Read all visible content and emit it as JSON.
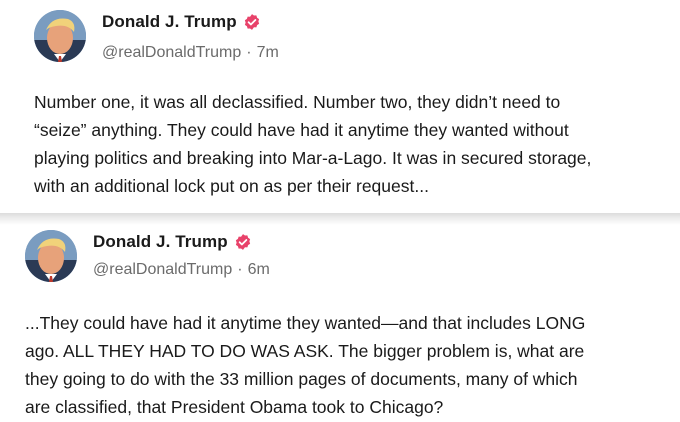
{
  "posts": [
    {
      "author": {
        "display_name": "Donald J. Trump",
        "verified": true,
        "handle": "@realDonaldTrump",
        "time": "7m"
      },
      "body": "Number one, it was all declassified. Number two, they didn’t need to\n“seize” anything. They could have had it anytime they wanted without\nplaying politics and breaking into Mar-a-Lago. It was in secured storage,\nwith an additional lock put on as per their request..."
    },
    {
      "author": {
        "display_name": "Donald J. Trump",
        "verified": true,
        "handle": "@realDonaldTrump",
        "time": "6m"
      },
      "body": "...They could have had it anytime they wanted—and that includes LONG\nago. ALL THEY HAD TO DO WAS ASK. The bigger problem is, what are\nthey going to do with the 33 million pages of documents, many of which\nare classified, that President Obama took to Chicago?"
    }
  ],
  "separator": "·",
  "colors": {
    "verified_badge": "#e8426a",
    "text": "#1a1a1a",
    "muted": "#6b6b6b"
  },
  "icons": {
    "verified": "verified-badge-icon",
    "avatar": "avatar"
  }
}
